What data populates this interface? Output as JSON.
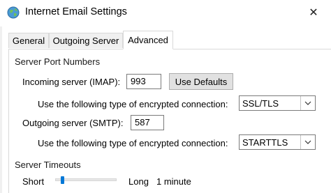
{
  "window": {
    "title": "Internet Email Settings",
    "close_glyph": "✕"
  },
  "tabs": [
    {
      "label": "General",
      "active": false
    },
    {
      "label": "Outgoing Server",
      "active": false
    },
    {
      "label": "Advanced",
      "active": true
    }
  ],
  "ports": {
    "section_title": "Server Port Numbers",
    "incoming_label": "Incoming server (IMAP):",
    "incoming_value": "993",
    "use_defaults_label": "Use Defaults",
    "incoming_encryption_label": "Use the following type of encrypted connection:",
    "incoming_encryption_value": "SSL/TLS",
    "outgoing_label": "Outgoing server (SMTP):",
    "outgoing_value": "587",
    "outgoing_encryption_label": "Use the following type of encrypted connection:",
    "outgoing_encryption_value": "STARTTLS"
  },
  "timeouts": {
    "section_title": "Server Timeouts",
    "short_label": "Short",
    "long_label": "Long",
    "value_label": "1 minute",
    "slider_level": 0.1
  },
  "colors": {
    "accent": "#0078d7"
  },
  "icons": {
    "app": "globe-icon",
    "close": "close-icon",
    "dropdown": "chevron-down-icon"
  }
}
